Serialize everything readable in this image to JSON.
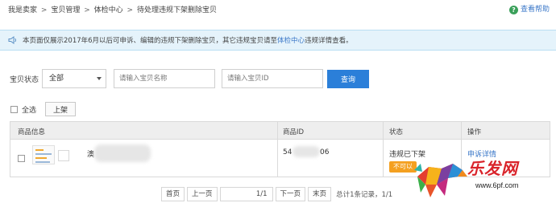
{
  "breadcrumb": {
    "items": [
      "我是卖家",
      "宝贝管理",
      "体检中心",
      "待处理违规下架删除宝贝"
    ],
    "separator": ">"
  },
  "help": {
    "label": "查看帮助",
    "icon": "question-icon",
    "icon_glyph": "?"
  },
  "notice": {
    "text_before": "本页面仅展示2017年6月以后可申诉、编辑的违规下架删除宝贝，其它违规宝贝请至",
    "link": "体检中心",
    "text_after": "违规详情查看。",
    "icon": "speaker-icon"
  },
  "filter": {
    "status_label": "宝贝状态",
    "status_value": "全部",
    "name_placeholder": "请输入宝贝名称",
    "id_placeholder": "请输入宝贝ID",
    "search_label": "查询"
  },
  "bulk": {
    "select_all_label": "全选",
    "shelve_label": "上架"
  },
  "table": {
    "columns": [
      "商品信息",
      "商品ID",
      "状态",
      "操作"
    ],
    "rows": [
      {
        "name_fragment": "澳",
        "id_start": "54",
        "id_end": "06",
        "status": "违规已下架",
        "badge": "不可以",
        "action": "申诉详情"
      }
    ]
  },
  "pagination": {
    "first": "首页",
    "prev": "上一页",
    "current": "1/1",
    "next": "下一页",
    "last": "末页",
    "summary": "总计1条记录，1/1"
  },
  "watermark": {
    "brand": "乐发网",
    "url": "www.6pf.com"
  },
  "colors": {
    "primary": "#2b7fd9",
    "link": "#3a77c8",
    "notice_bg": "#e5f3fb",
    "badge": "#f4a020",
    "brand_red": "#d9232a"
  }
}
